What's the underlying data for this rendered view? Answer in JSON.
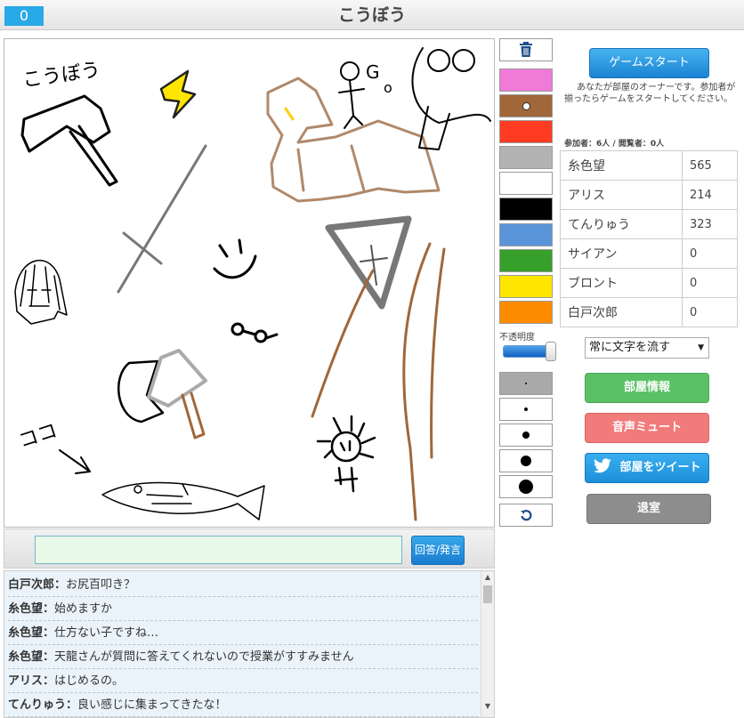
{
  "header": {
    "score": "0",
    "title": "こうぼう"
  },
  "canvas": {
    "doodle_texts": [
      "こうぼう",
      "ココ",
      "G",
      "o"
    ]
  },
  "palette": {
    "trash_icon": "trash-icon",
    "colors": [
      "#f07ad8",
      "#a0673a",
      "#ff3b22",
      "#b3b3b3",
      "#ffffff",
      "#000000",
      "#5a94d9",
      "#36a02a",
      "#ffe600",
      "#ff8b00"
    ],
    "opacity_label": "不透明度",
    "opacity_value": 0.95,
    "undo_icon": "undo-icon"
  },
  "room": {
    "start_button": "ゲームスタート",
    "owner_note": "あなたが部屋のオーナーです。参加者が揃ったらゲームをスタートしてください。",
    "participants": "参加者：6人 / 閲覧者：0人",
    "players": [
      {
        "name": "糸色望",
        "score": "565"
      },
      {
        "name": "アリス",
        "score": "214"
      },
      {
        "name": "てんりゅう",
        "score": "323"
      },
      {
        "name": "サイアン",
        "score": "0"
      },
      {
        "name": "ブロント",
        "score": "0"
      },
      {
        "name": "白戸次郎",
        "score": "0"
      }
    ],
    "text_mode": "常に文字を流す",
    "info_button": "部屋情報",
    "mute_button": "音声ミュート",
    "tweet_button": "部屋をツイート",
    "leave_button": "退室"
  },
  "input": {
    "value": "",
    "send_button": "回答/発言"
  },
  "chat": [
    {
      "who": "白戸次郎",
      "msg": "お尻百叩き？"
    },
    {
      "who": "糸色望",
      "msg": "始めますか"
    },
    {
      "who": "糸色望",
      "msg": "仕方ない子ですね…"
    },
    {
      "who": "糸色望",
      "msg": "天龍さんが質問に答えてくれないので授業がすすみません"
    },
    {
      "who": "アリス",
      "msg": "はじめるの。"
    },
    {
      "who": "てんりゅう",
      "msg": "良い感じに集まってきたな！"
    }
  ]
}
